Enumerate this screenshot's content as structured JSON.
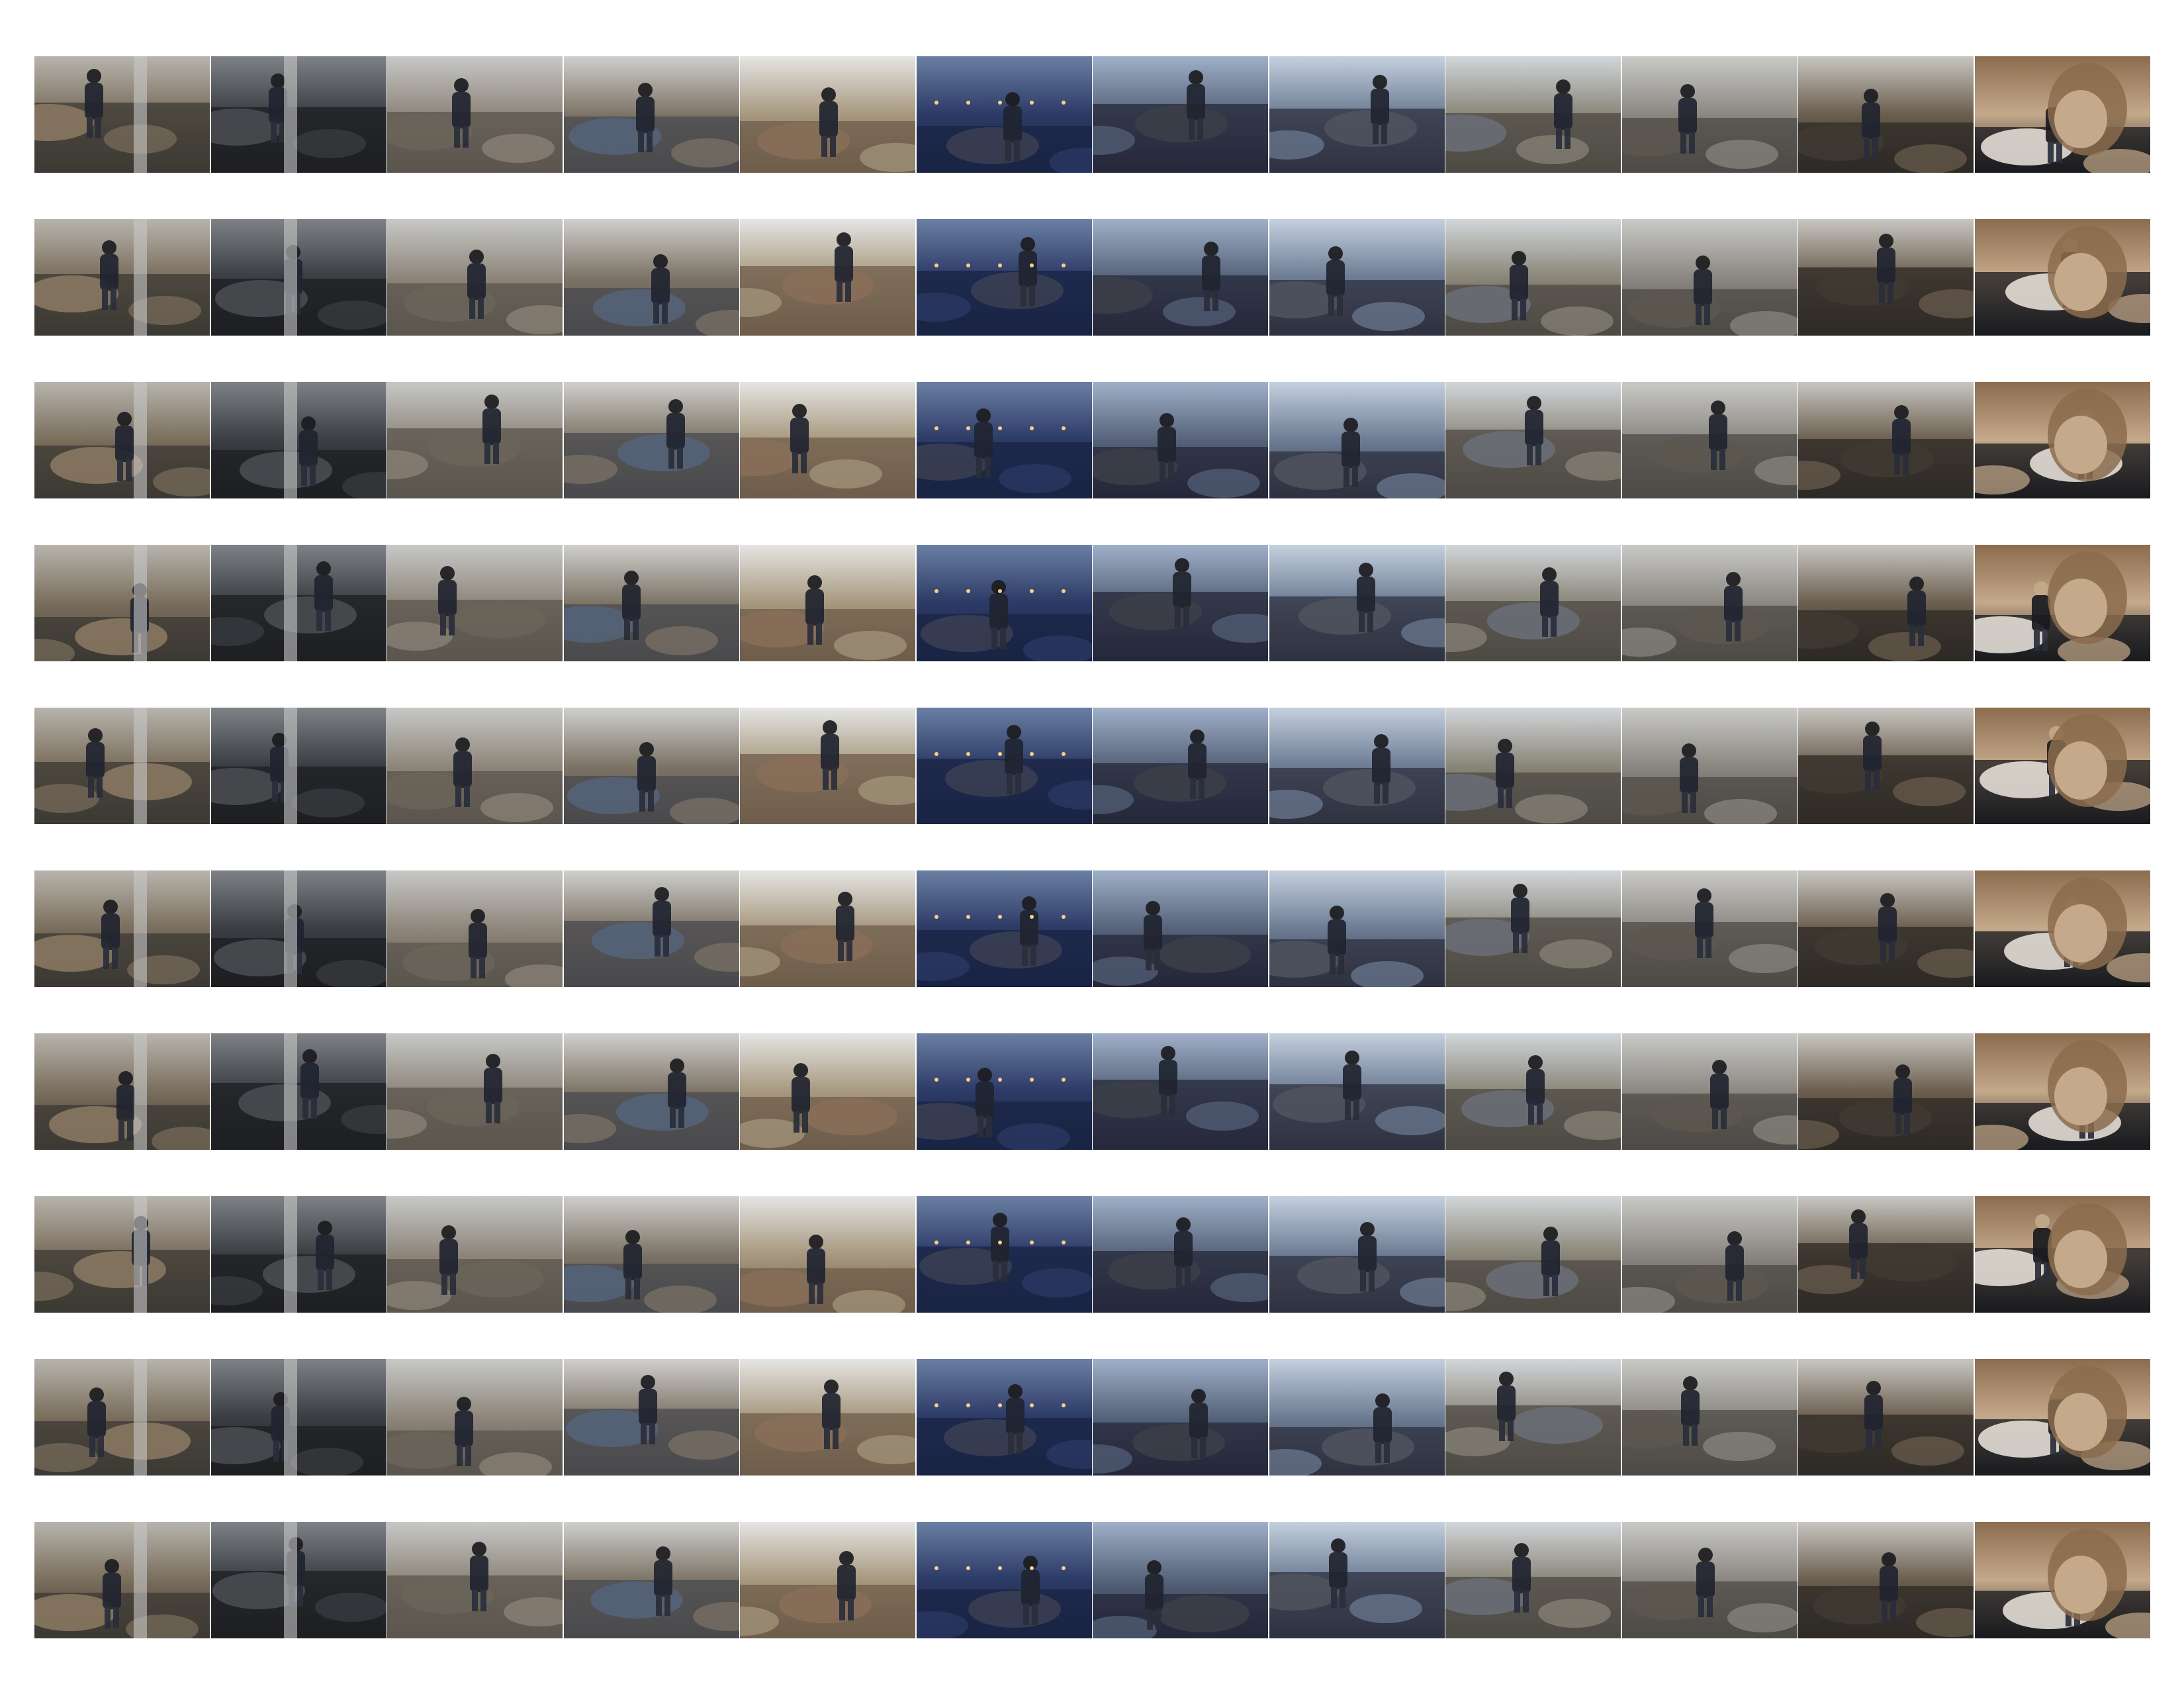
{
  "contact_sheet": {
    "rows": 10,
    "columns": 12,
    "column_scenes": [
      "river-under-bridge",
      "dark-bridge-underpass",
      "man-photographing-rocks",
      "man-with-camera",
      "fort-and-beach",
      "boardwalk-at-dusk",
      "woman-on-rocky-coast",
      "woman-on-pebble-beach",
      "coastal-trees-and-sea",
      "stone-fort-ruins",
      "woods-and-fort",
      "smiling-woman-portrait"
    ],
    "palettes": [
      [
        "#3c3a34",
        "#7a6e5c",
        "#b7b4ad",
        "#8c7a64"
      ],
      [
        "#1d1f22",
        "#3a3d42",
        "#7e8186",
        "#4b4e52"
      ],
      [
        "#5b564e",
        "#8e867b",
        "#c7c8c6",
        "#6a6459"
      ],
      [
        "#4a4a4e",
        "#7d7466",
        "#cfcfcd",
        "#55647a"
      ],
      [
        "#6f5d4b",
        "#a7987f",
        "#e5e5e3",
        "#8a6e58"
      ],
      [
        "#1a2444",
        "#2c3a66",
        "#6a7fa3",
        "#3b3f52"
      ],
      [
        "#25283a",
        "#56637a",
        "#9fb0c8",
        "#3c3f49"
      ],
      [
        "#2f3240",
        "#6d7c94",
        "#c5d0de",
        "#4f535e"
      ],
      [
        "#4d4a44",
        "#8a8679",
        "#d2d6da",
        "#6b6f78"
      ],
      [
        "#4e4b47",
        "#8b8882",
        "#c9c9c6",
        "#5c574f"
      ],
      [
        "#2e2a25",
        "#6b5e4e",
        "#c8c6c2",
        "#3f3a33"
      ],
      [
        "#1a1b1f",
        "#c4a98a",
        "#8b6c4e",
        "#ede7df"
      ]
    ]
  }
}
